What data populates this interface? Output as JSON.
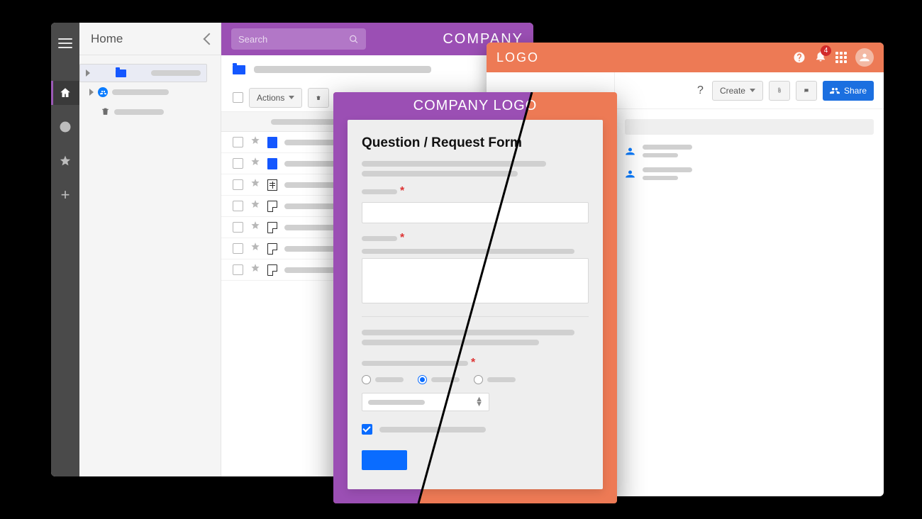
{
  "left_app": {
    "tree_title": "Home",
    "search_placeholder": "Search",
    "brand": "COMPANY",
    "actions_label": "Actions"
  },
  "right_app": {
    "logo": "LOGO",
    "notif_count": "4",
    "create_label": "Create",
    "share_label": "Share"
  },
  "form": {
    "brand": "COMPANY LOGO",
    "title": "Question / Request Form"
  }
}
